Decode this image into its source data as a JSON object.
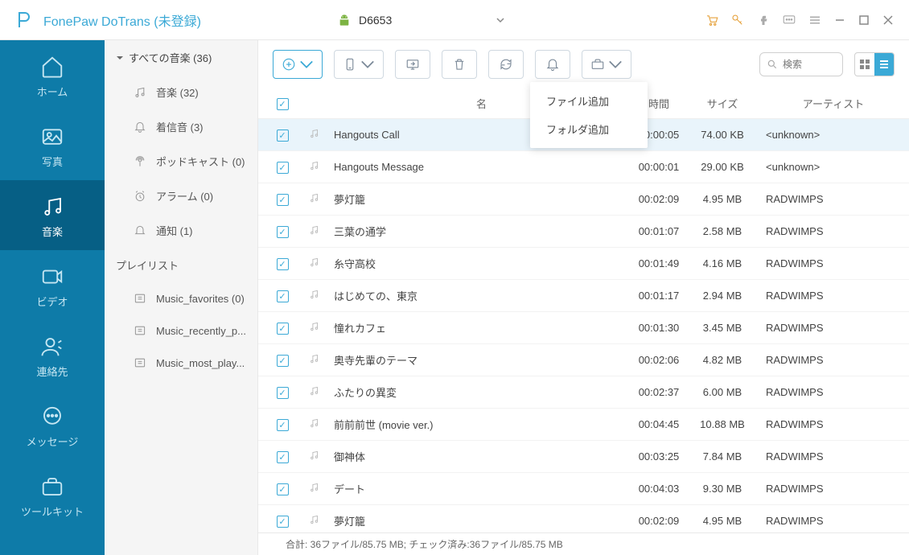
{
  "app_title": "FonePaw DoTrans (未登録)",
  "device_name": "D6653",
  "nav": [
    {
      "key": "home",
      "label": "ホーム"
    },
    {
      "key": "photo",
      "label": "写真"
    },
    {
      "key": "music",
      "label": "音楽"
    },
    {
      "key": "video",
      "label": "ビデオ"
    },
    {
      "key": "contacts",
      "label": "連絡先"
    },
    {
      "key": "messages",
      "label": "メッセージ"
    },
    {
      "key": "toolkit",
      "label": "ツールキット"
    }
  ],
  "sidebar": {
    "header": "すべての音楽 (36)",
    "items": [
      {
        "key": "music",
        "label": "音楽 (32)"
      },
      {
        "key": "ringtones",
        "label": "着信音 (3)"
      },
      {
        "key": "podcasts",
        "label": "ポッドキャスト (0)"
      },
      {
        "key": "alarms",
        "label": "アラーム (0)"
      },
      {
        "key": "notifications",
        "label": "通知 (1)"
      }
    ],
    "playlist_header": "プレイリスト",
    "playlists": [
      {
        "label": "Music_favorites (0)"
      },
      {
        "label": "Music_recently_p..."
      },
      {
        "label": "Music_most_play..."
      }
    ]
  },
  "dropdown": {
    "add_file": "ファイル追加",
    "add_folder": "フォルダ追加"
  },
  "search_placeholder": "検索",
  "columns": {
    "name": "名",
    "time": "時間",
    "size": "サイズ",
    "artist": "アーティスト"
  },
  "rows": [
    {
      "name": "Hangouts Call",
      "time": "00:00:05",
      "size": "74.00 KB",
      "artist": "<unknown>",
      "sel": true
    },
    {
      "name": "Hangouts Message",
      "time": "00:00:01",
      "size": "29.00 KB",
      "artist": "<unknown>",
      "sel": false
    },
    {
      "name": "夢灯籠",
      "time": "00:02:09",
      "size": "4.95 MB",
      "artist": "RADWIMPS",
      "sel": false
    },
    {
      "name": "三葉の通学",
      "time": "00:01:07",
      "size": "2.58 MB",
      "artist": "RADWIMPS",
      "sel": false
    },
    {
      "name": "糸守高校",
      "time": "00:01:49",
      "size": "4.16 MB",
      "artist": "RADWIMPS",
      "sel": false
    },
    {
      "name": "はじめての、東京",
      "time": "00:01:17",
      "size": "2.94 MB",
      "artist": "RADWIMPS",
      "sel": false
    },
    {
      "name": "憧れカフェ",
      "time": "00:01:30",
      "size": "3.45 MB",
      "artist": "RADWIMPS",
      "sel": false
    },
    {
      "name": "奥寺先輩のテーマ",
      "time": "00:02:06",
      "size": "4.82 MB",
      "artist": "RADWIMPS",
      "sel": false
    },
    {
      "name": "ふたりの異変",
      "time": "00:02:37",
      "size": "6.00 MB",
      "artist": "RADWIMPS",
      "sel": false
    },
    {
      "name": "前前前世 (movie ver.)",
      "time": "00:04:45",
      "size": "10.88 MB",
      "artist": "RADWIMPS",
      "sel": false
    },
    {
      "name": "御神体",
      "time": "00:03:25",
      "size": "7.84 MB",
      "artist": "RADWIMPS",
      "sel": false
    },
    {
      "name": "デート",
      "time": "00:04:03",
      "size": "9.30 MB",
      "artist": "RADWIMPS",
      "sel": false
    },
    {
      "name": "夢灯籠",
      "time": "00:02:09",
      "size": "4.95 MB",
      "artist": "RADWIMPS",
      "sel": false
    }
  ],
  "statusbar": "合計: 36ファイル/85.75 MB; チェック済み:36ファイル/85.75 MB"
}
